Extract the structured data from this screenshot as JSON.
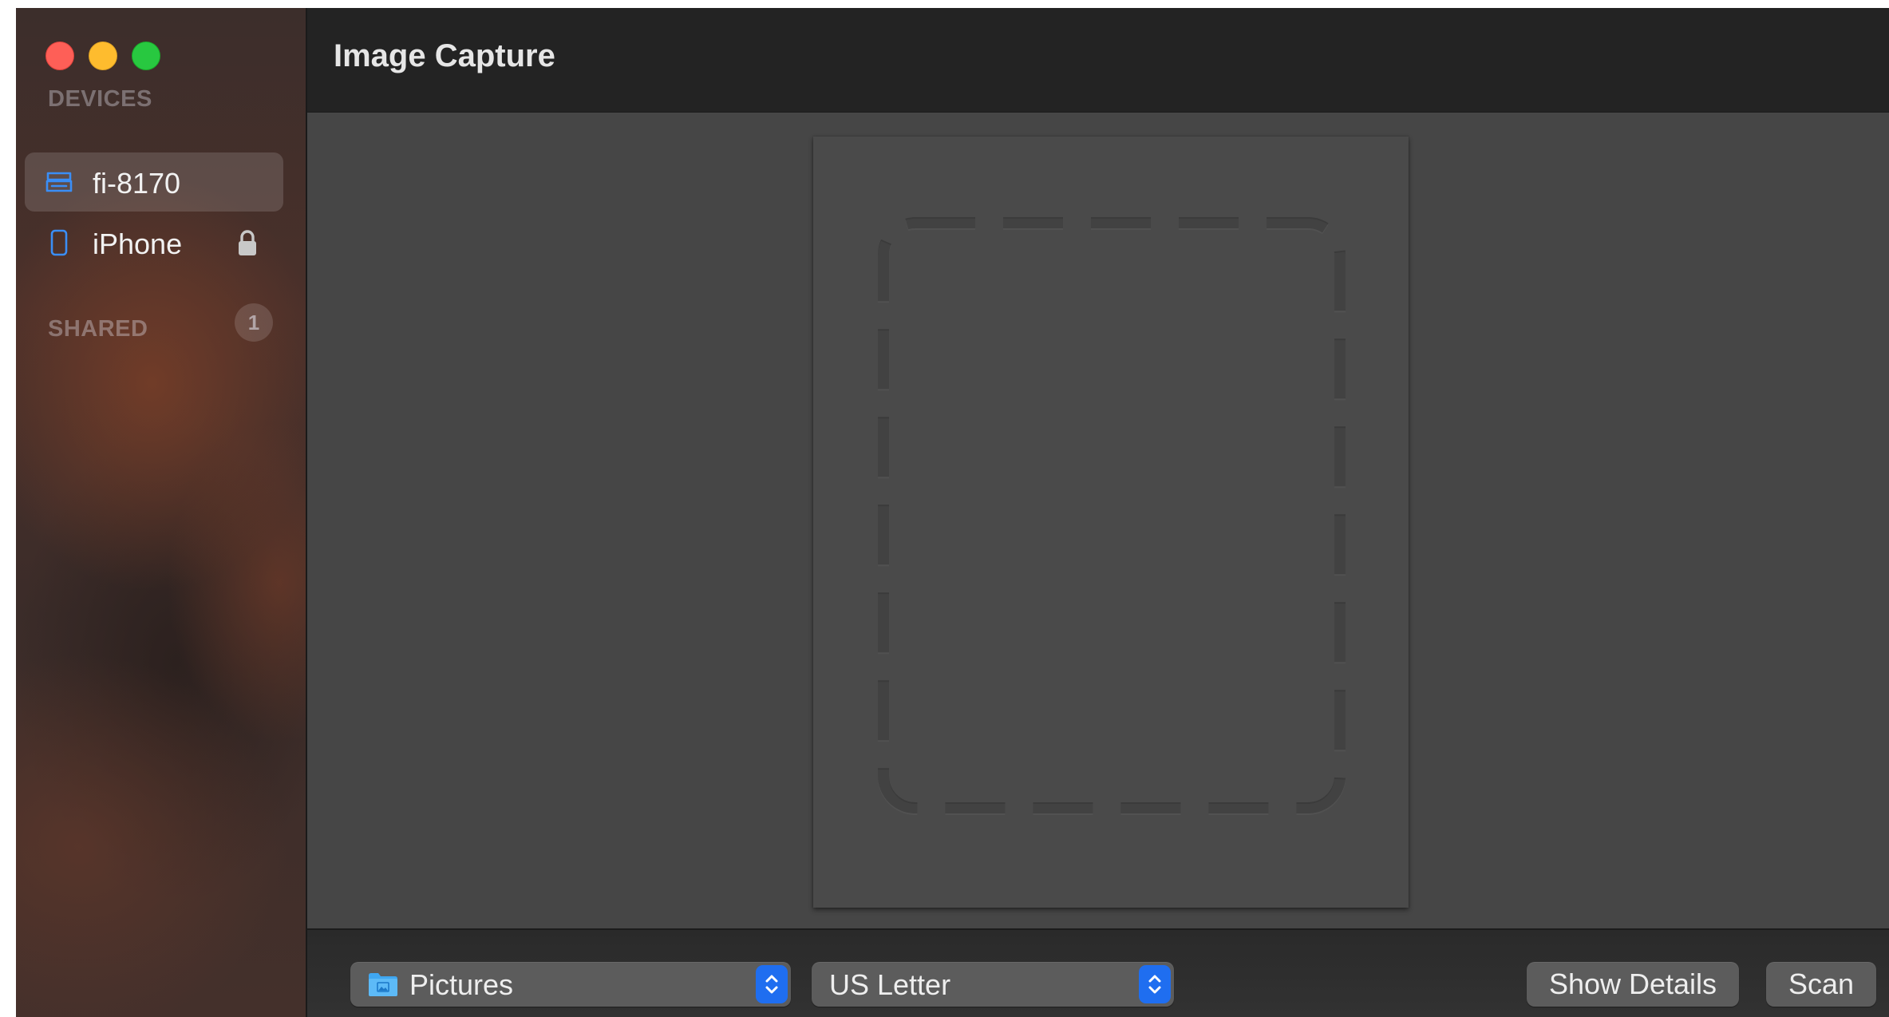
{
  "window": {
    "title": "Image Capture"
  },
  "sidebar": {
    "devices_header": "DEVICES",
    "devices": [
      {
        "label": "fi-8170",
        "icon": "scanner-icon",
        "selected": true
      },
      {
        "label": "iPhone",
        "icon": "iphone-icon",
        "locked": true
      }
    ],
    "shared_header": "SHARED",
    "shared_count": "1"
  },
  "toolbar": {
    "destination_value": "Pictures",
    "destination_icon": "pictures-folder-icon",
    "paper_size_value": "US Letter",
    "show_details_label": "Show Details",
    "scan_label": "Scan"
  },
  "colors": {
    "accent": "#1f6ef0",
    "icon_blue": "#3a8ef6",
    "close": "#fe5f57",
    "minimize": "#febc2e",
    "zoom": "#28c840"
  }
}
